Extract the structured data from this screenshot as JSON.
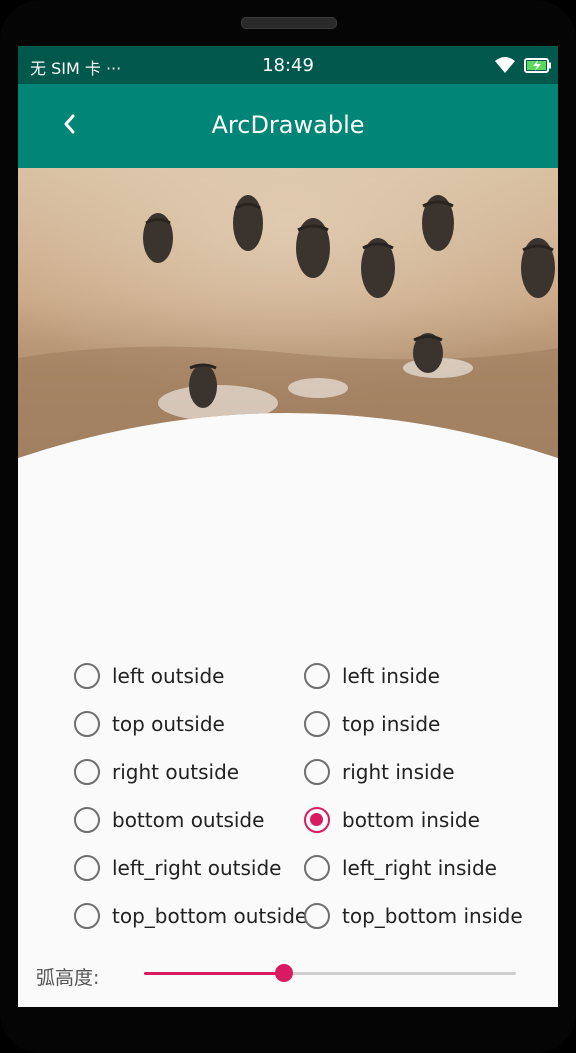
{
  "status_bar": {
    "carrier": "无 SIM 卡 ···",
    "time": "18:49",
    "wifi_icon": "wifi-icon",
    "battery_icon": "battery-charging-icon"
  },
  "app_bar": {
    "title": "ArcDrawable",
    "back_icon": "chevron-left-icon",
    "color": "#008577",
    "status_color": "#00574b"
  },
  "image": {
    "description_icon": "wildebeest-photo"
  },
  "options": [
    {
      "label": "left outside",
      "selected": false
    },
    {
      "label": "left inside",
      "selected": false
    },
    {
      "label": "top outside",
      "selected": false
    },
    {
      "label": "top inside",
      "selected": false
    },
    {
      "label": "right outside",
      "selected": false
    },
    {
      "label": "right inside",
      "selected": false
    },
    {
      "label": "bottom outside",
      "selected": false
    },
    {
      "label": "bottom inside",
      "selected": true
    },
    {
      "label": "left_right outside",
      "selected": false
    },
    {
      "label": "left_right inside",
      "selected": false
    },
    {
      "label": "top_bottom outside",
      "selected": false
    },
    {
      "label": "top_bottom inside",
      "selected": false
    }
  ],
  "slider": {
    "label": "弧高度:",
    "value_fraction": 0.375,
    "accent": "#d81b60"
  }
}
